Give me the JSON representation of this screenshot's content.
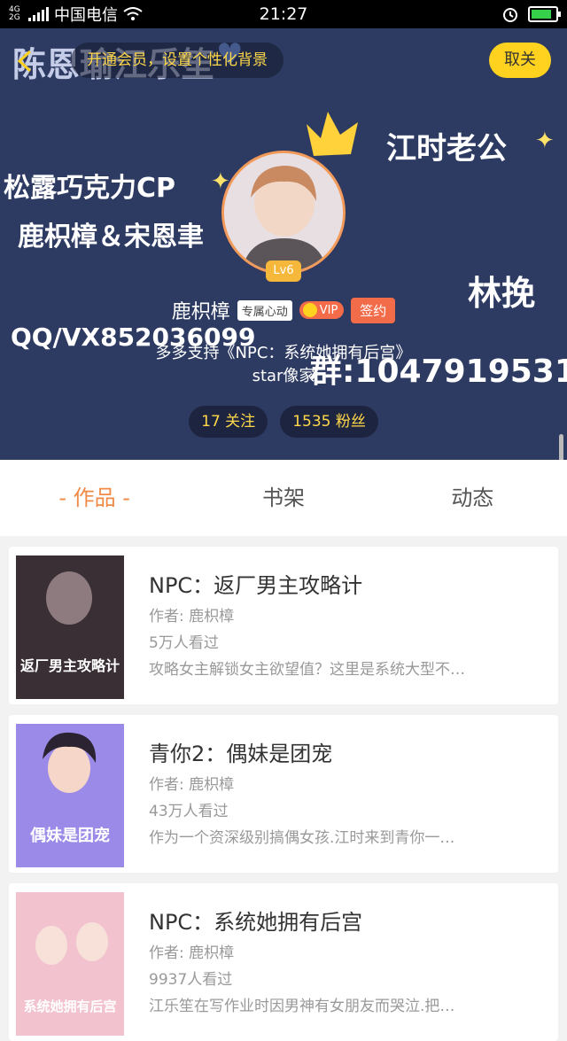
{
  "status": {
    "carrier": "中国电信",
    "net_top": "4G",
    "net_bottom": "2G",
    "time": "21:27"
  },
  "header": {
    "customize_label": "开通会员，设置个性化背景",
    "close_label": "取关",
    "deco": [
      "陈恩瑜江乐笙",
      "松露巧克力CP",
      "鹿枳樟＆宋恩聿",
      "江时老公",
      "林挽",
      "QQ/VX852036099",
      "群:1047919531"
    ],
    "level": "Lv6",
    "username": "鹿枳樟",
    "tag": "专属心动",
    "vip_label": "VIP",
    "sign_label": "签约",
    "bio_line1": "多多支持《NPC：系统她拥有后宫》",
    "bio_line2": "star像家",
    "following": "17 关注",
    "fans": "1535 粉丝",
    "colors": {
      "bg": "#2d3a62",
      "accent": "#ffd21f"
    }
  },
  "tabs": [
    "- 作品 -",
    "书架",
    "动态"
  ],
  "books": [
    {
      "title": "NPC：返厂男主攻略计",
      "author": "作者: 鹿枳樟",
      "reads": "5万人看过",
      "desc": "攻略女主解锁女主欲望值？这里是系统大型不…",
      "cover_color": "#3a2f35",
      "cover_text": "返厂男主攻略计"
    },
    {
      "title": "青你2：偶妹是团宠",
      "author": "作者: 鹿枳樟",
      "reads": "43万人看过",
      "desc": "作为一个资深级别搞偶女孩.江时来到青你一…",
      "cover_color": "#9b8ae8",
      "cover_text": "偶妹是团宠"
    },
    {
      "title": "NPC：系统她拥有后宫",
      "author": "作者: 鹿枳樟",
      "reads": "9937人看过",
      "desc": "江乐笙在写作业时因男神有女朋友而哭泣.把…",
      "cover_color": "#f2c3cf",
      "cover_text": "系统她拥有后宫"
    }
  ]
}
